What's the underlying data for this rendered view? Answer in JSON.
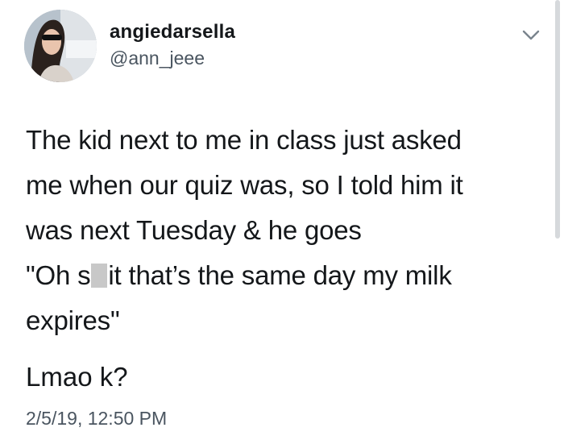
{
  "user": {
    "display_name": "angiedarsella",
    "handle": "@ann_jeee",
    "avatar_icon": "profile-photo"
  },
  "menu": {
    "icon": "chevron-down-icon"
  },
  "tweet": {
    "lines": [
      "The kid next to me in class just asked",
      "me when our quiz was, so I told him it",
      "was next Tuesday & he goes"
    ],
    "censored_line_prefix": "\"Oh s",
    "censored_line_suffix": "it that’s the same day my milk",
    "last_line": "expires\"",
    "reply": "Lmao k?"
  },
  "meta": {
    "timestamp": "2/5/19, 12:50 PM"
  },
  "colors": {
    "text": "#14171a",
    "secondary": "#4a5560",
    "censor_block": "#c8c8c8"
  }
}
